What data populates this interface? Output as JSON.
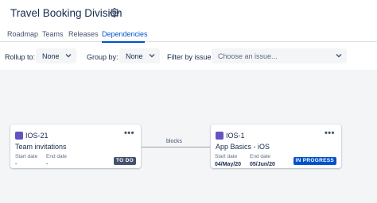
{
  "page": {
    "title": "Travel Booking Division"
  },
  "tabs": [
    {
      "label": "Roadmap"
    },
    {
      "label": "Teams"
    },
    {
      "label": "Releases"
    },
    {
      "label": "Dependencies"
    }
  ],
  "filters": {
    "rollup": {
      "label": "Rollup to:",
      "value": "None"
    },
    "groupby": {
      "label": "Group by:",
      "value": "None"
    },
    "issue": {
      "label": "Filter by issue:",
      "placeholder": "Choose an issue..."
    }
  },
  "cards": [
    {
      "key": "IOS-21",
      "summary": "Team invitations",
      "start_label": "Start date",
      "end_label": "End date",
      "start": "-",
      "end": "-",
      "status": "TO DO"
    },
    {
      "key": "IOS-1",
      "summary": "App Basics - iOS",
      "start_label": "Start date",
      "end_label": "End date",
      "start": "04/May/20",
      "end": "05/Jun/20",
      "status": "IN PROGRESS"
    }
  ],
  "link": {
    "label": "blocks"
  },
  "colors": {
    "accent": "#0052cc",
    "story": "#6554c0",
    "todo": "#42526e"
  },
  "icons": {
    "settings": "gear-icon",
    "story": "story-icon",
    "more": "more-icon",
    "dropdown": "chevron-down-icon"
  }
}
